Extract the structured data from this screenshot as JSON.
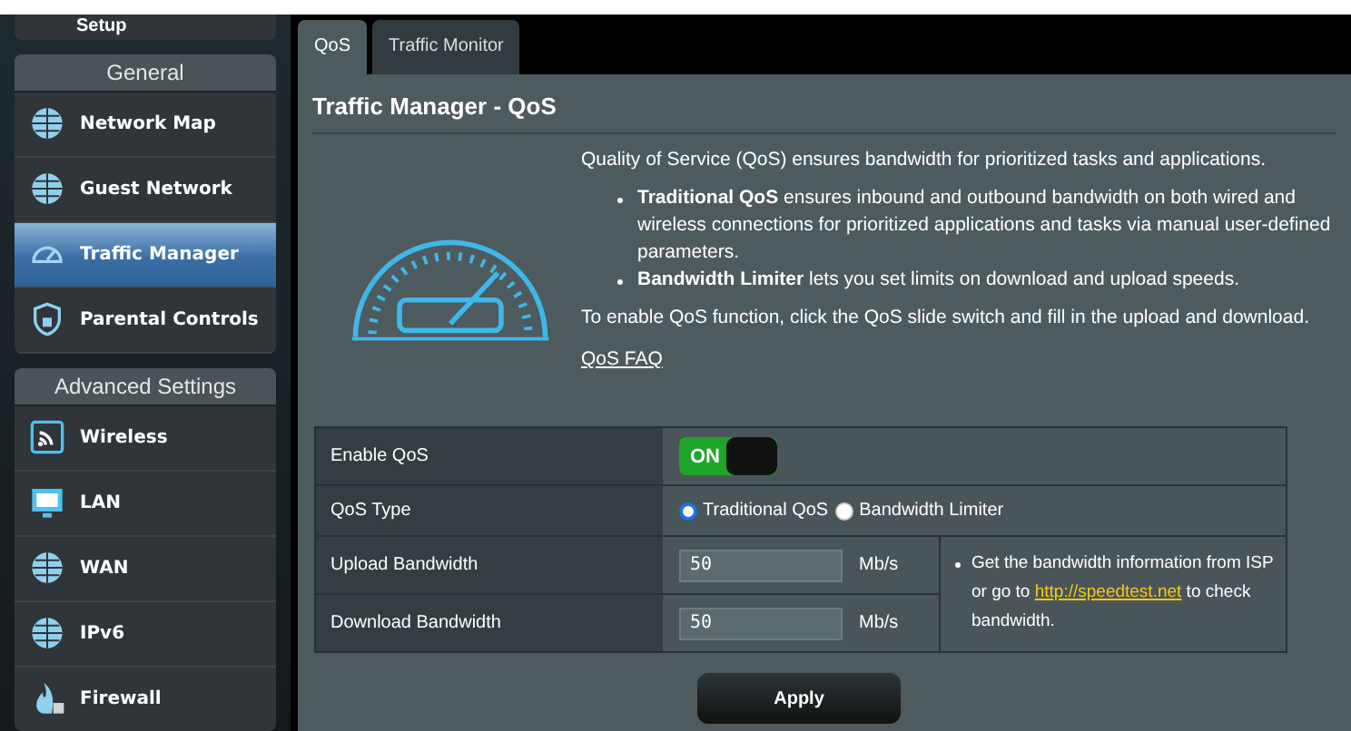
{
  "sidebar": {
    "top_item": {
      "label": "Setup"
    },
    "groups": [
      {
        "title": "General",
        "items": [
          {
            "label": "Network Map",
            "selected": false
          },
          {
            "label": "Guest Network",
            "selected": false
          },
          {
            "label": "Traffic Manager",
            "selected": true
          },
          {
            "label": "Parental Controls",
            "selected": false
          }
        ]
      },
      {
        "title": "Advanced Settings",
        "items": [
          {
            "label": "Wireless",
            "selected": false
          },
          {
            "label": "LAN",
            "selected": false
          },
          {
            "label": "WAN",
            "selected": false
          },
          {
            "label": "IPv6",
            "selected": false
          },
          {
            "label": "Firewall",
            "selected": false
          }
        ]
      }
    ]
  },
  "tabs": [
    {
      "label": "QoS",
      "selected": true
    },
    {
      "label": "Traffic Monitor",
      "selected": false
    }
  ],
  "title": "Traffic Manager - QoS",
  "intro": {
    "lead": "Quality of Service (QoS) ensures bandwidth for prioritized tasks and applications.",
    "bullets": [
      "**Traditional QoS** ensures inbound and outbound bandwidth on both wired and wireless connections for prioritized applications and tasks via manual user-defined parameters.",
      "**Bandwidth Limiter** lets you set limits on download and upload speeds."
    ],
    "note": "To enable QoS function, click the QoS slide switch and fill in the upload and download.",
    "faq_link": "QoS FAQ"
  },
  "settings": {
    "enable": {
      "label": "Enable QoS",
      "on": true,
      "on_text": "ON"
    },
    "type": {
      "label": "QoS Type",
      "options": [
        {
          "label": "Traditional QoS",
          "selected": true
        },
        {
          "label": "Bandwidth Limiter",
          "selected": false
        }
      ]
    },
    "bandwidth": [
      {
        "label": "Upload Bandwidth",
        "value": "50",
        "unit": "Mb/s"
      },
      {
        "label": "Download Bandwidth",
        "value": "50",
        "unit": "Mb/s"
      }
    ],
    "hint": {
      "before": "Get the bandwidth information from ISP or go to",
      "link": "http://speedtest.net",
      "after": "to check bandwidth."
    }
  },
  "apply_button": "Apply"
}
